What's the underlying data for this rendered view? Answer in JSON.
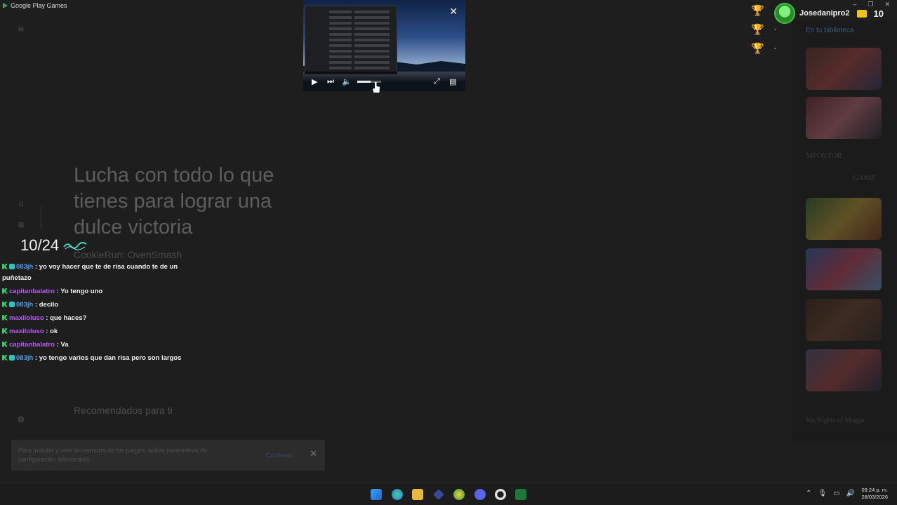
{
  "window": {
    "title": "Google Play Games"
  },
  "hero": {
    "title": "Lucha con todo lo que tienes para lograr una dulce victoria",
    "game_name": "CookieRun: OvenSmash"
  },
  "recommended_label": "Recomendados para ti",
  "counter": "10/24",
  "chat": [
    {
      "user": "083jh",
      "user_color": "#4a9ff5",
      "badges": [
        "green",
        "teal"
      ],
      "message": ": yo voy hacer que te de risa cuando te de un puñetazo"
    },
    {
      "user": "capitanbalatro",
      "user_color": "#b65cf2",
      "badges": [
        "green"
      ],
      "message": ": Yo tengo uno"
    },
    {
      "user": "083jh",
      "user_color": "#4a9ff5",
      "badges": [
        "green",
        "teal"
      ],
      "message": ": decilo"
    },
    {
      "user": "maxiloluso",
      "user_color": "#b65cf2",
      "badges": [
        "green"
      ],
      "message": ": que haces?"
    },
    {
      "user": "maxiloluso",
      "user_color": "#b65cf2",
      "badges": [
        "green"
      ],
      "message": ": ok"
    },
    {
      "user": "capitanbalatro",
      "user_color": "#b65cf2",
      "badges": [
        "green"
      ],
      "message": ": Va"
    },
    {
      "user": "083jh",
      "user_color": "#4a9ff5",
      "badges": [
        "green",
        "teal"
      ],
      "message": ": yo tengo varios que dan risa pero son largos"
    }
  ],
  "toast": {
    "message": "Para instalar y usar la memoria de los juegos, activa parámetros de configuración adicionales.",
    "action": "Continuar"
  },
  "profile": {
    "username": "Josedanipro2",
    "coins": "10"
  },
  "trophies": [
    {
      "name": "gold-trophy",
      "color": "#e3b11a",
      "count": ""
    },
    {
      "name": "silver-trophy",
      "color": "#bdbdbd",
      "count": "-"
    },
    {
      "name": "bronze-trophy",
      "color": "#d9772b",
      "count": "-"
    }
  ],
  "library": {
    "title": "En tu biblioteca",
    "impostor_text": "MPOSTOR",
    "game_text": "GAME",
    "last_text": "Wa Nights of Magga"
  },
  "pip": {
    "progress": 0.55
  },
  "taskbar": {
    "time": "09:24 p. m.",
    "date": "28/03/2026"
  },
  "colors": {
    "accent_green": "#2fcf6a",
    "user_blue": "#4a9ff5",
    "user_purple": "#b65cf2",
    "coin": "#f2c21b"
  }
}
